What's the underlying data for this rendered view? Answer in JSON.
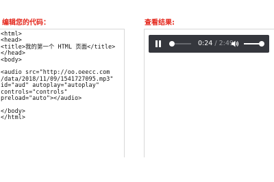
{
  "editor": {
    "title": "编辑您的代码：",
    "code_lines": [
      "<html>",
      "<head>",
      "<title>我的第一个 HTML 页面</title>",
      "</head>",
      "<body>",
      "",
      "<audio src=\"http://oo.oeecc.com",
      "/data/2018/11/09/1541727095.mp3\"",
      "id=\"aud\" autoplay=\"autoplay\"",
      "controls=\"controls\"",
      "preload=\"auto\"></audio>",
      "",
      "</body>",
      "</html>"
    ]
  },
  "result": {
    "title": "查看结果:",
    "player": {
      "current_time": "0:24",
      "separator": " / ",
      "duration": "2:49",
      "progress_fraction": 0.14,
      "volume_fraction": 0.85,
      "icons": [
        "pause-icon",
        "volume-icon"
      ],
      "colors": {
        "background": "#35373d",
        "foreground": "#ffffff",
        "muted": "#9ea0a4"
      }
    }
  },
  "colors": {
    "title": "#e4261b"
  }
}
